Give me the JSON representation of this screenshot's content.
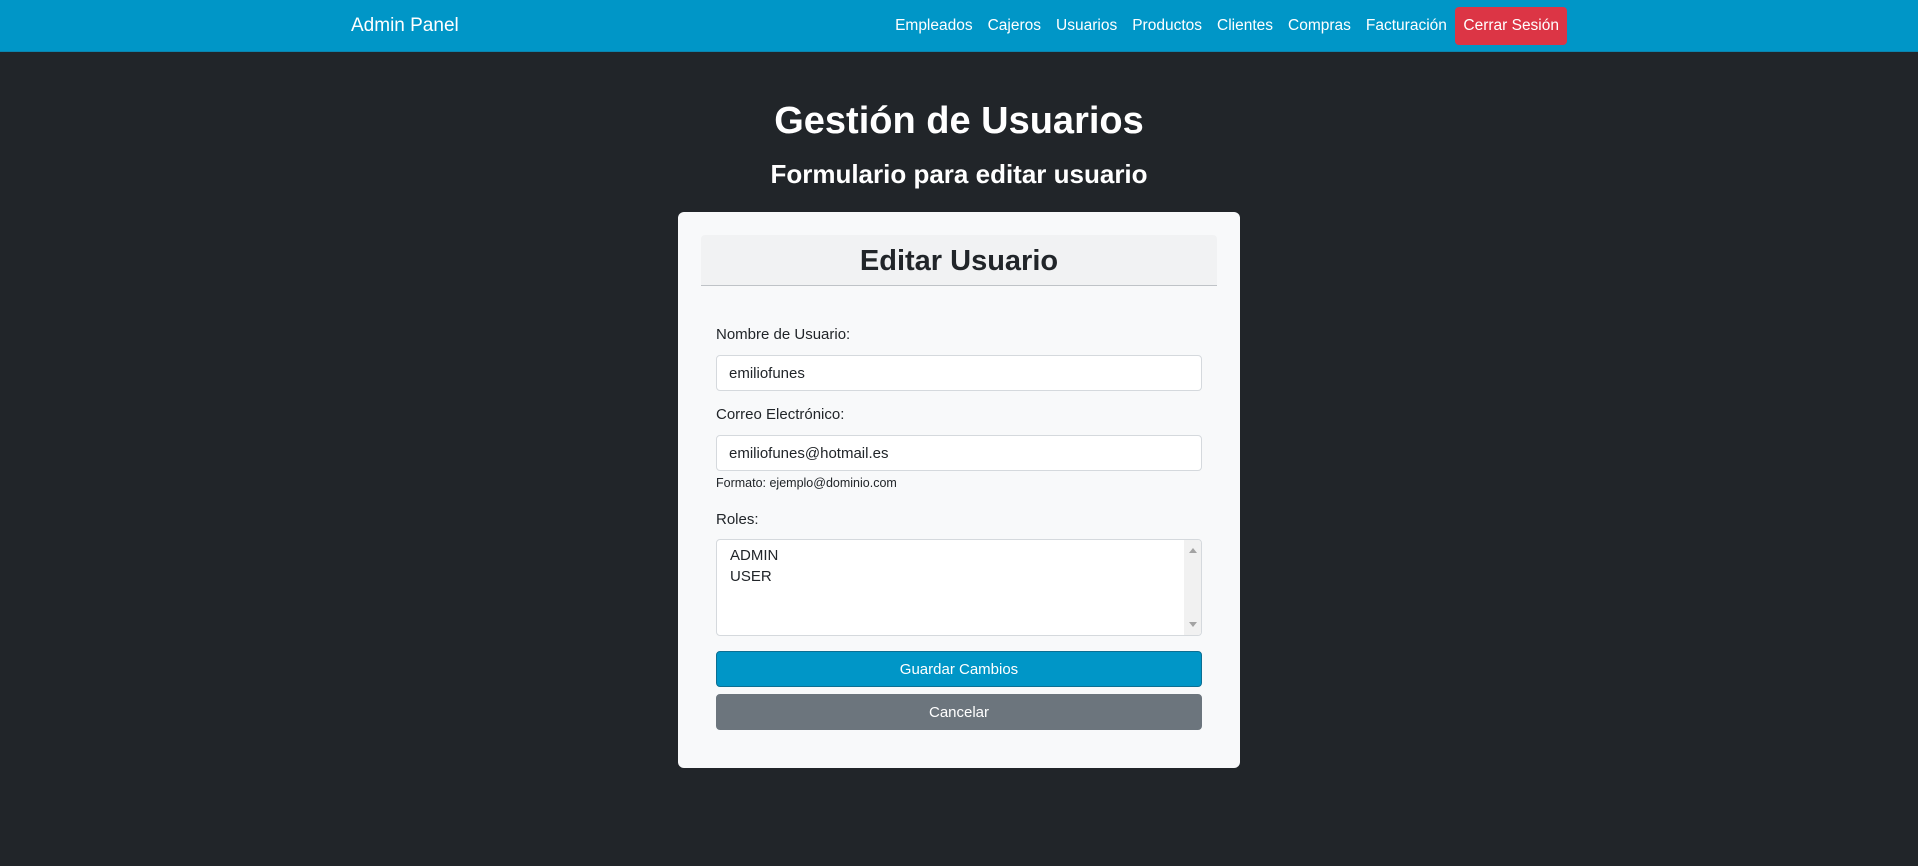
{
  "navbar": {
    "brand": "Admin Panel",
    "links": [
      {
        "label": "Empleados"
      },
      {
        "label": "Cajeros"
      },
      {
        "label": "Usuarios"
      },
      {
        "label": "Productos"
      },
      {
        "label": "Clientes"
      },
      {
        "label": "Compras"
      },
      {
        "label": "Facturación"
      }
    ],
    "logout_label": "Cerrar Sesión"
  },
  "page": {
    "title": "Gestión de Usuarios",
    "subtitle": "Formulario para editar usuario"
  },
  "form": {
    "header": "Editar Usuario",
    "username_label": "Nombre de Usuario:",
    "username_value": "emiliofunes",
    "email_label": "Correo Electrónico:",
    "email_value": "emiliofunes@hotmail.es",
    "email_help": "Formato: ejemplo@dominio.com",
    "roles_label": "Roles:",
    "roles": [
      "ADMIN",
      "USER"
    ],
    "save_label": "Guardar Cambios",
    "cancel_label": "Cancelar"
  },
  "colors": {
    "navbar": "#0096c7",
    "background": "#212529",
    "logout": "#dc3545",
    "primary": "#0096c7",
    "secondary": "#6c757d",
    "card": "#f8f9fa"
  }
}
